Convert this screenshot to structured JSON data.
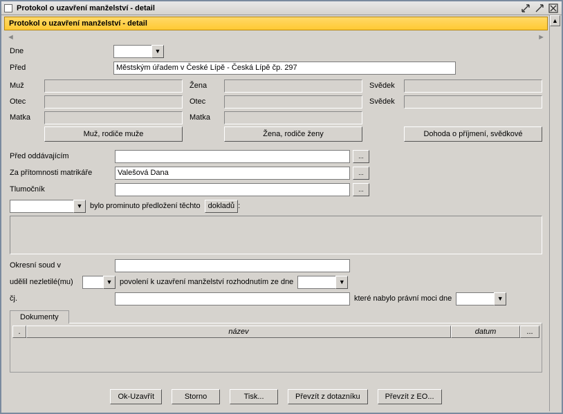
{
  "window": {
    "title": "Protokol o uzavření manželství - detail"
  },
  "header": {
    "title": "Protokol o uzavření manželství - detail"
  },
  "form": {
    "dne_label": "Dne",
    "dne_value": "",
    "pred_label": "Před",
    "pred_value": "Městským úřadem v České Lípě - Česká Lípě čp. 297",
    "muz_label": "Muž",
    "muz_value": "",
    "otec_m_label": "Otec",
    "otec_m_value": "",
    "matka_m_label": "Matka",
    "matka_m_value": "",
    "zena_label": "Žena",
    "zena_value": "",
    "otec_z_label": "Otec",
    "otec_z_value": "",
    "matka_z_label": "Matka",
    "matka_z_value": "",
    "svedek1_label": "Svědek",
    "svedek1_value": "",
    "svedek2_label": "Svědek",
    "svedek2_value": "",
    "btn_muz": "Muž, rodiče muže",
    "btn_zena": "Žena, rodiče ženy",
    "btn_dohoda": "Dohoda o příjmení, svědkové",
    "pred_odd_label": "Před oddávajícím",
    "pred_odd_value": "",
    "za_prit_label": "Za přítomnosti matrikáře",
    "za_prit_value": "Valešová Dana",
    "tlumocnik_label": "Tlumočník",
    "tlumocnik_value": "",
    "prominuto_text": "bylo prominuto předložení těchto",
    "dokladu_btn": "dokladů",
    "okresni_label": "Okresní soud v",
    "okresni_value": "",
    "udelil_label": "udělil nezletilé(mu)",
    "udelil_value": "",
    "povoleni_text": "povolení k uzavření manželství rozhodnutím ze dne",
    "povoleni_date": "",
    "cj_label": "čj.",
    "cj_value": "",
    "ktere_text": "které nabylo právní moci dne",
    "ktere_date": ""
  },
  "tabs": {
    "dokumenty": "Dokumenty",
    "col_dot": ".",
    "col_name": "název",
    "col_date": "datum",
    "col_end": "..."
  },
  "buttons": {
    "ok": "Ok-Uzavřít",
    "storno": "Storno",
    "tisk": "Tisk...",
    "prevzit_dotaznik": "Převzít z dotazníku",
    "prevzit_eo": "Převzít z EO...",
    "dots": "..."
  }
}
